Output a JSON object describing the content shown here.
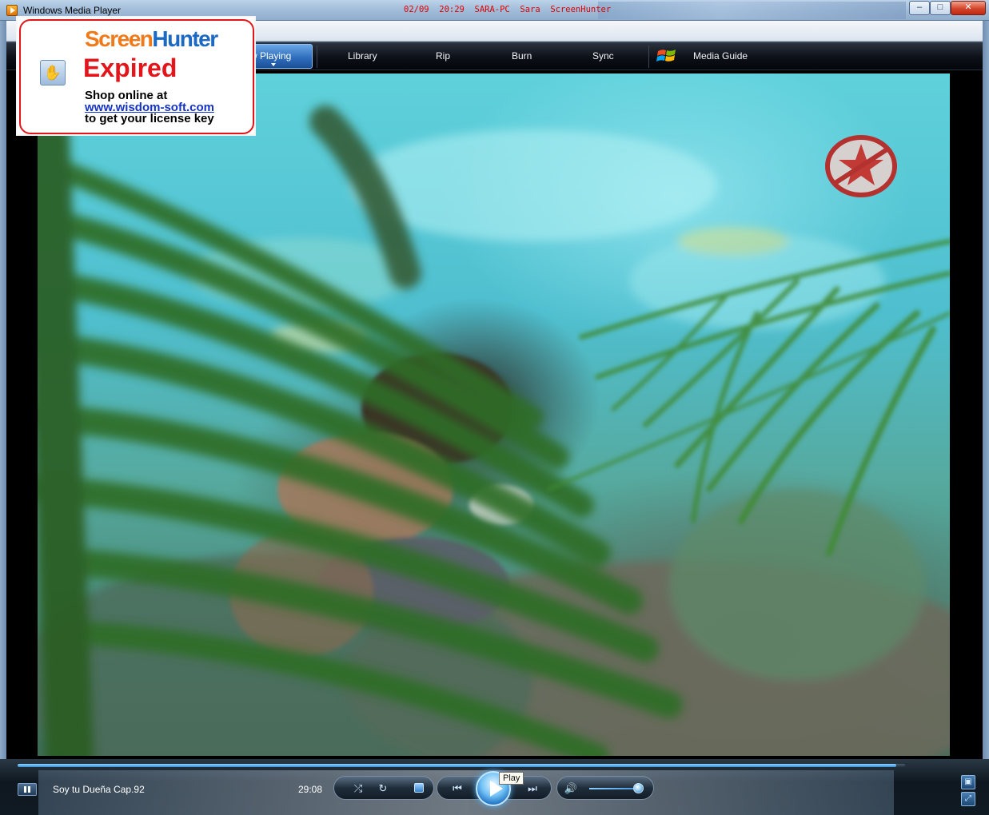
{
  "window": {
    "title": "Windows Media Player",
    "watermark_stamp": "02/09  20:29  SARA-PC  Sara  ScreenHunter",
    "controls": {
      "minimize": "–",
      "maximize": "□",
      "close": "✕"
    }
  },
  "nav": {
    "tabs": [
      {
        "label": "Now Playing",
        "visible_label": "w Playing",
        "active": true
      },
      {
        "label": "Library"
      },
      {
        "label": "Rip"
      },
      {
        "label": "Burn"
      },
      {
        "label": "Sync"
      },
      {
        "label": "Media Guide",
        "icon": "windows-flag-icon"
      }
    ]
  },
  "player": {
    "now_playing_title": "Soy tu Dueña Cap.92",
    "elapsed_time": "29:08",
    "seek_progress": 0.99,
    "volume_level": 0.9,
    "tooltip": "Play",
    "accent_color": "#3a8fd6",
    "icons": {
      "shuffle": "shuffle-icon",
      "repeat": "repeat-icon",
      "stop": "stop-icon",
      "previous": "previous-icon",
      "play": "play-icon",
      "next": "next-icon",
      "volume": "speaker-icon",
      "switch_to_compact": "switch-view-icon",
      "fullscreen": "fullscreen-icon"
    }
  },
  "screenhunter": {
    "logo_part1": "Screen",
    "logo_part2": "Hunter",
    "status": "Expired",
    "line1": "Shop online at",
    "link": "www.wisdom-soft.com",
    "line3": "to get your license key",
    "border_color": "#e3141a"
  }
}
